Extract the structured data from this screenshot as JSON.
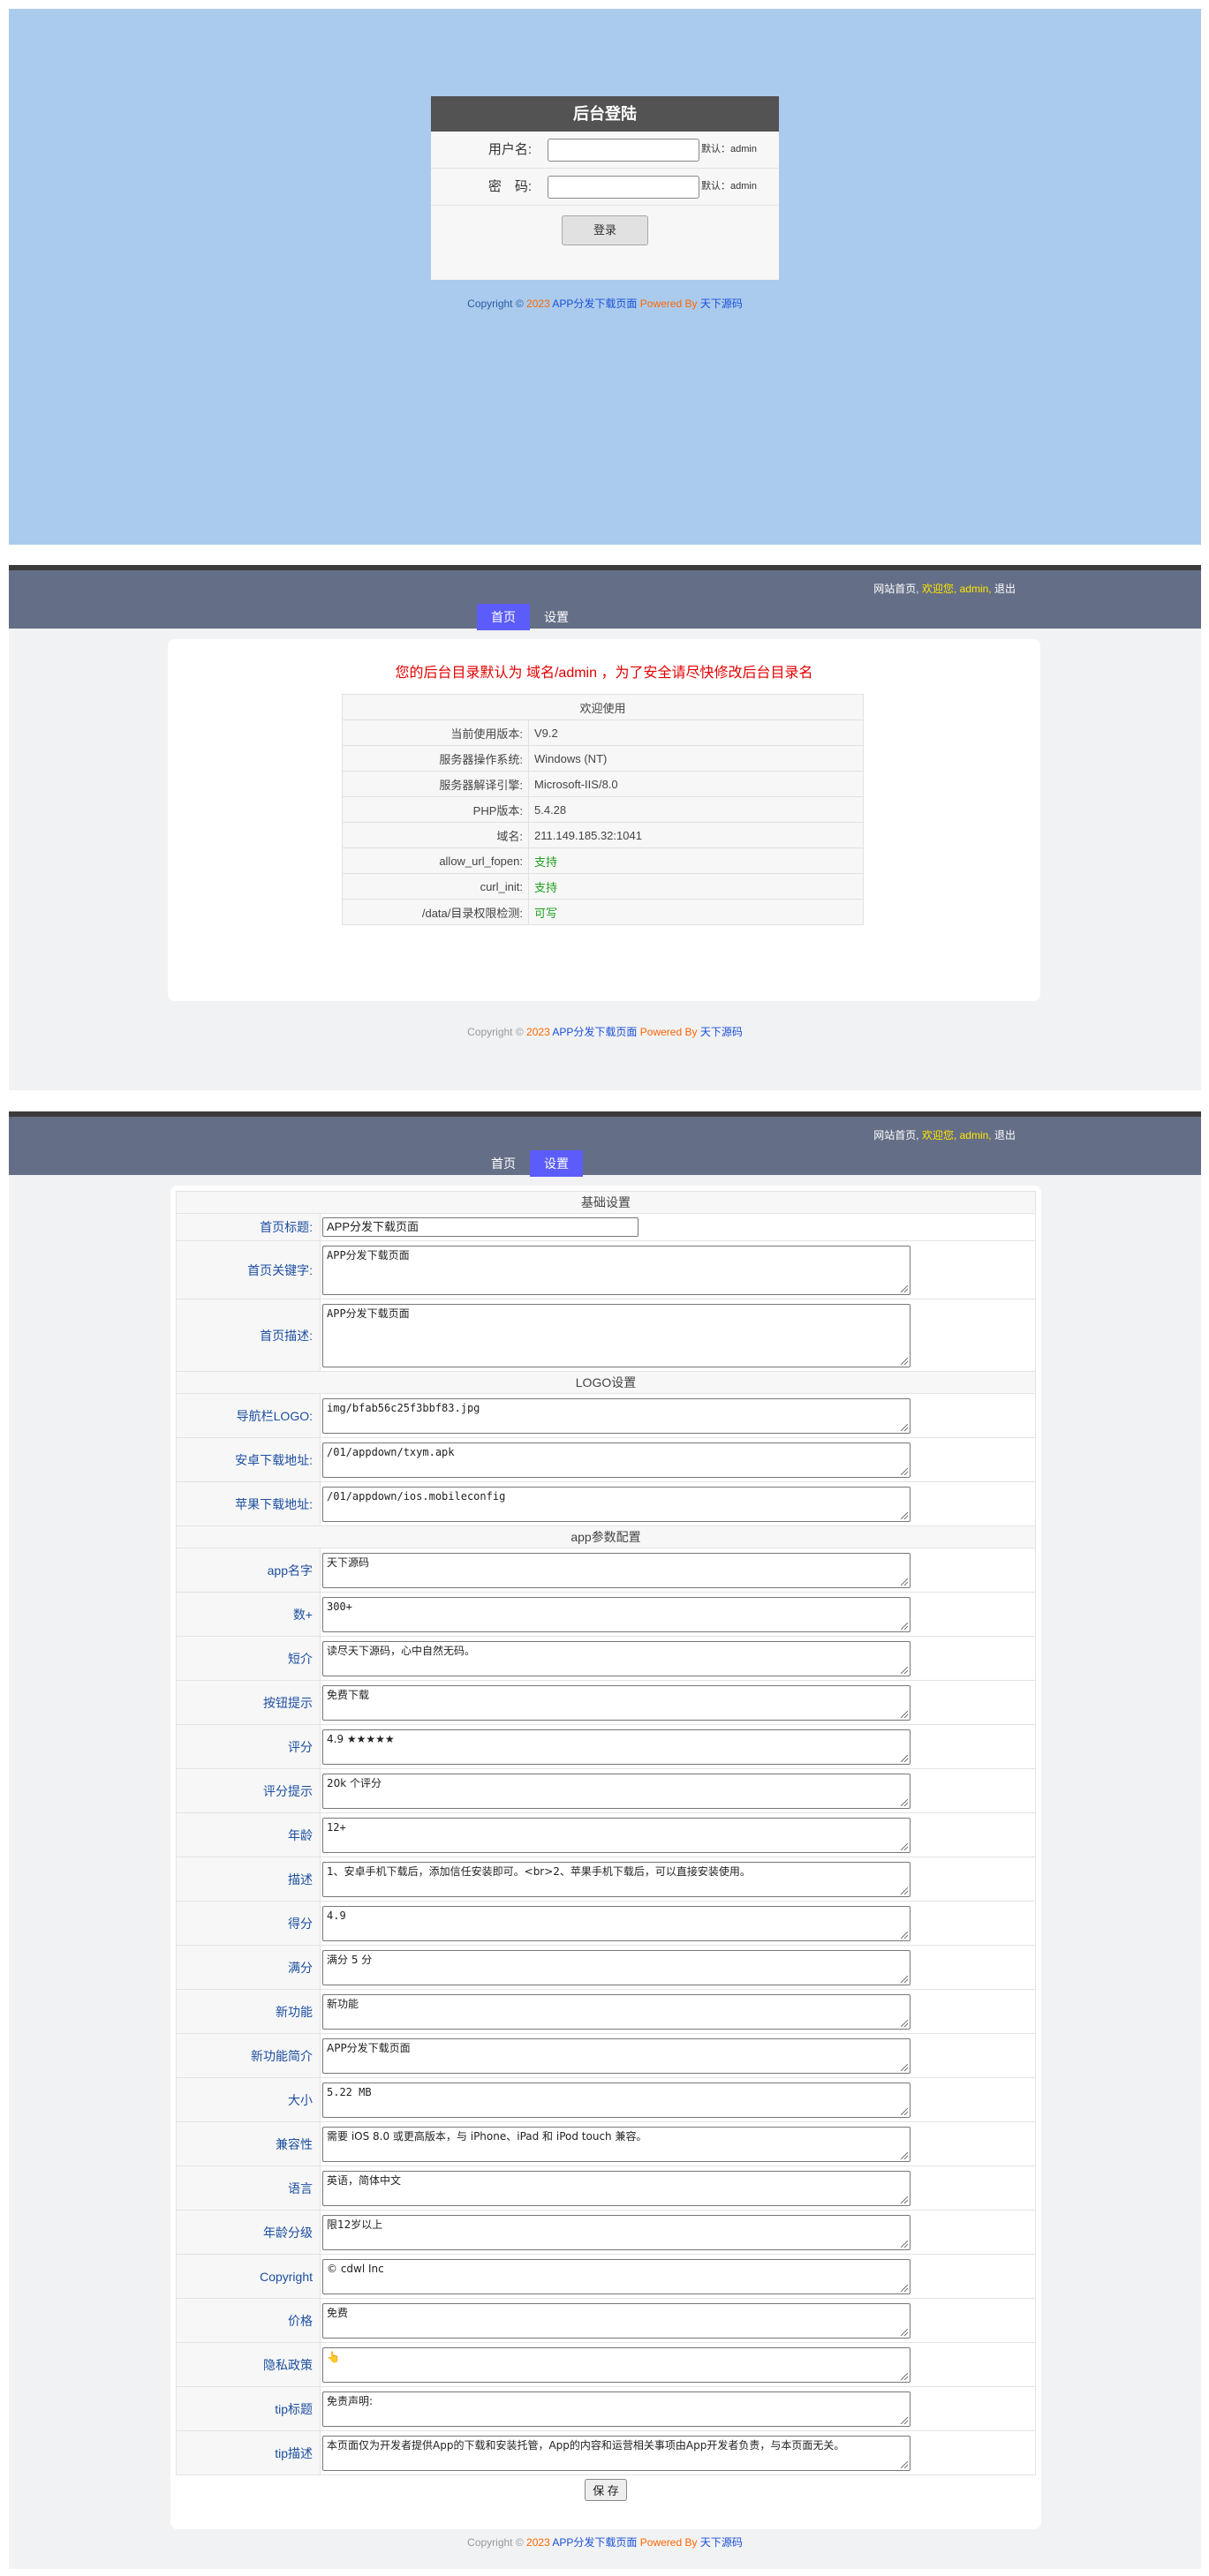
{
  "login": {
    "title": "后台登陆",
    "username_label": "用户名:",
    "password_label": "密　码:",
    "username_hint": "默认：admin",
    "password_hint": "默认：admin",
    "submit_label": "登录"
  },
  "footer": {
    "prefix": "Copyright ©",
    "year": "2023",
    "site": "APP分发下载页面",
    "powered": "Powered By",
    "brand": "天下源码"
  },
  "topbar": {
    "site_home": "网站首页,",
    "welcome": "欢迎您,",
    "user": "admin,",
    "logout": "退出"
  },
  "nav": {
    "home": "首页",
    "settings": "设置"
  },
  "dashboard": {
    "warning": "您的后台目录默认为 域名/admin ，为了安全请尽快修改后台目录名",
    "table_title": "欢迎使用",
    "rows": [
      {
        "key": "当前使用版本:",
        "value": "V9.2"
      },
      {
        "key": "服务器操作系统:",
        "value": "Windows (NT)"
      },
      {
        "key": "服务器解译引擎:",
        "value": "Microsoft-IIS/8.0"
      },
      {
        "key": "PHP版本:",
        "value": "5.4.28"
      },
      {
        "key": "域名:",
        "value": "211.149.185.32:1041"
      },
      {
        "key": "allow_url_fopen:",
        "value": "支持"
      },
      {
        "key": "curl_init:",
        "value": "支持"
      },
      {
        "key": "/data/目录权限检测:",
        "value": "可写"
      }
    ]
  },
  "settings": {
    "section_basic": "基础设置",
    "section_logo": "LOGO设置",
    "section_app": "app参数配置",
    "home_title_label": "首页标题:",
    "home_title_value": "APP分发下载页面",
    "keywords_label": "首页关键字:",
    "keywords_value": "APP分发下载页面",
    "desc_label": "首页描述:",
    "desc_value": "APP分发下载页面",
    "logo_label": "导航栏LOGO:",
    "logo_value": "img/bfab56c25f3bbf83.jpg",
    "android_label": "安卓下载地址:",
    "android_value": "/01/appdown/txym.apk",
    "ios_label": "苹果下载地址:",
    "ios_value": "/01/appdown/ios.mobileconfig",
    "app_fields": [
      {
        "label": "app名字",
        "value": "天下源码"
      },
      {
        "label": "数+",
        "value": "300+"
      },
      {
        "label": "短介",
        "value": "读尽天下源码，心中自然无码。"
      },
      {
        "label": "按钮提示",
        "value": "免费下载"
      },
      {
        "label": "评分",
        "value": "4.9 ★★★★★"
      },
      {
        "label": "评分提示",
        "value": "20k 个评分"
      },
      {
        "label": "年龄",
        "value": "12+"
      },
      {
        "label": "描述",
        "value": "1、安卓手机下载后，添加信任安装即可。<br>2、苹果手机下载后，可以直接安装使用。"
      },
      {
        "label": "得分",
        "value": "4.9"
      },
      {
        "label": "满分",
        "value": "满分 5 分"
      },
      {
        "label": "新功能",
        "value": "新功能"
      },
      {
        "label": "新功能简介",
        "value": "APP分发下载页面"
      },
      {
        "label": "大小",
        "value": "5.22 MB"
      },
      {
        "label": "兼容性",
        "value": "需要 iOS 8.0 或更高版本，与 iPhone、iPad 和 iPod touch 兼容。"
      },
      {
        "label": "语言",
        "value": "英语，简体中文"
      },
      {
        "label": "年龄分级",
        "value": "限12岁以上"
      },
      {
        "label": "Copyright",
        "value": "© cdwl Inc"
      },
      {
        "label": "价格",
        "value": "免费"
      },
      {
        "label": "隐私政策",
        "value": "👆"
      },
      {
        "label": "tip标题",
        "value": "免责声明:"
      },
      {
        "label": "tip描述",
        "value": "本页面仅为开发者提供App的下载和安装托管，App的内容和运营相关事项由App开发者负责，与本页面无关。"
      }
    ],
    "save_label": "保 存"
  }
}
